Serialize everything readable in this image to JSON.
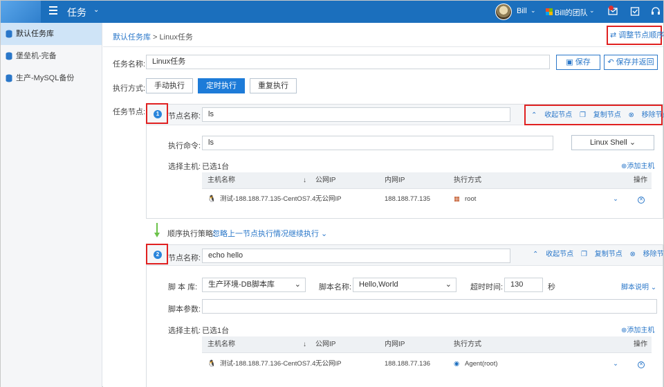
{
  "header": {
    "app_title": "任务",
    "user_name": "Bill",
    "team_name": "Bill的团队"
  },
  "sidebar": {
    "items": [
      {
        "label": "默认任务库",
        "active": true
      },
      {
        "label": "堡垒机-完备",
        "active": false
      },
      {
        "label": "生产-MySQL备份",
        "active": false
      }
    ]
  },
  "breadcrumb": {
    "root": "默认任务库",
    "separator": " > ",
    "current": "Linux任务"
  },
  "reorder_label": "调整节点顺序",
  "form": {
    "task_name_label": "任务名称:",
    "task_name_value": "Linux任务",
    "save_label": "保存",
    "save_return_label": "保存并返回",
    "exec_mode_label": "执行方式:",
    "exec_modes": [
      "手动执行",
      "定时执行",
      "重复执行"
    ],
    "task_nodes_label": "任务节点:"
  },
  "node1": {
    "number": "1",
    "name_label": "节点名称:",
    "name_value": "ls",
    "collapse_label": "收起节点",
    "copy_label": "复制节点",
    "remove_label": "移除节点",
    "command_label": "执行命令:",
    "command_value": "ls",
    "shell_select": "Linux Shell",
    "host_label": "选择主机:",
    "host_count": "已选1台",
    "add_host_label": "添加主机",
    "table_headers": [
      "主机名称",
      "公网IP",
      "内网IP",
      "执行方式",
      "操作"
    ],
    "rows": [
      {
        "host": "测试-188.188.77.135-CentOS7.4",
        "public_ip": "无公网IP",
        "private_ip": "188.188.77.135",
        "exec": "root"
      }
    ]
  },
  "strategy": {
    "label": "顺序执行策略:",
    "value": "忽略上一节点执行情况继续执行"
  },
  "node2": {
    "number": "2",
    "name_label": "节点名称:",
    "name_value": "echo hello",
    "collapse_label": "收起节点",
    "copy_label": "复制节点",
    "remove_label": "移除节点",
    "script_lib_label": "脚 本 库:",
    "script_lib_value": "生产环境-DB脚本库",
    "script_name_label": "脚本名称:",
    "script_name_value": "Hello,World",
    "timeout_label": "超时时间:",
    "timeout_value": "130",
    "timeout_unit": "秒",
    "script_help": "脚本说明",
    "script_param_label": "脚本参数:",
    "host_label": "选择主机:",
    "host_count": "已选1台",
    "add_host_label": "添加主机",
    "table_headers": [
      "主机名称",
      "公网IP",
      "内网IP",
      "执行方式",
      "操作"
    ],
    "rows": [
      {
        "host": "测试-188.188.77.136-CentOS7.4",
        "public_ip": "无公网IP",
        "private_ip": "188.188.77.136",
        "exec": "Agent(root)"
      }
    ]
  },
  "colors": {
    "topbar": "#1b6fbd",
    "accent": "#2a77c9",
    "highlight_box": "#e02020",
    "primary_button": "#1d7bd8",
    "sidebar_active": "#cfe4f7",
    "strategy_arrow": "#6cc24a"
  }
}
